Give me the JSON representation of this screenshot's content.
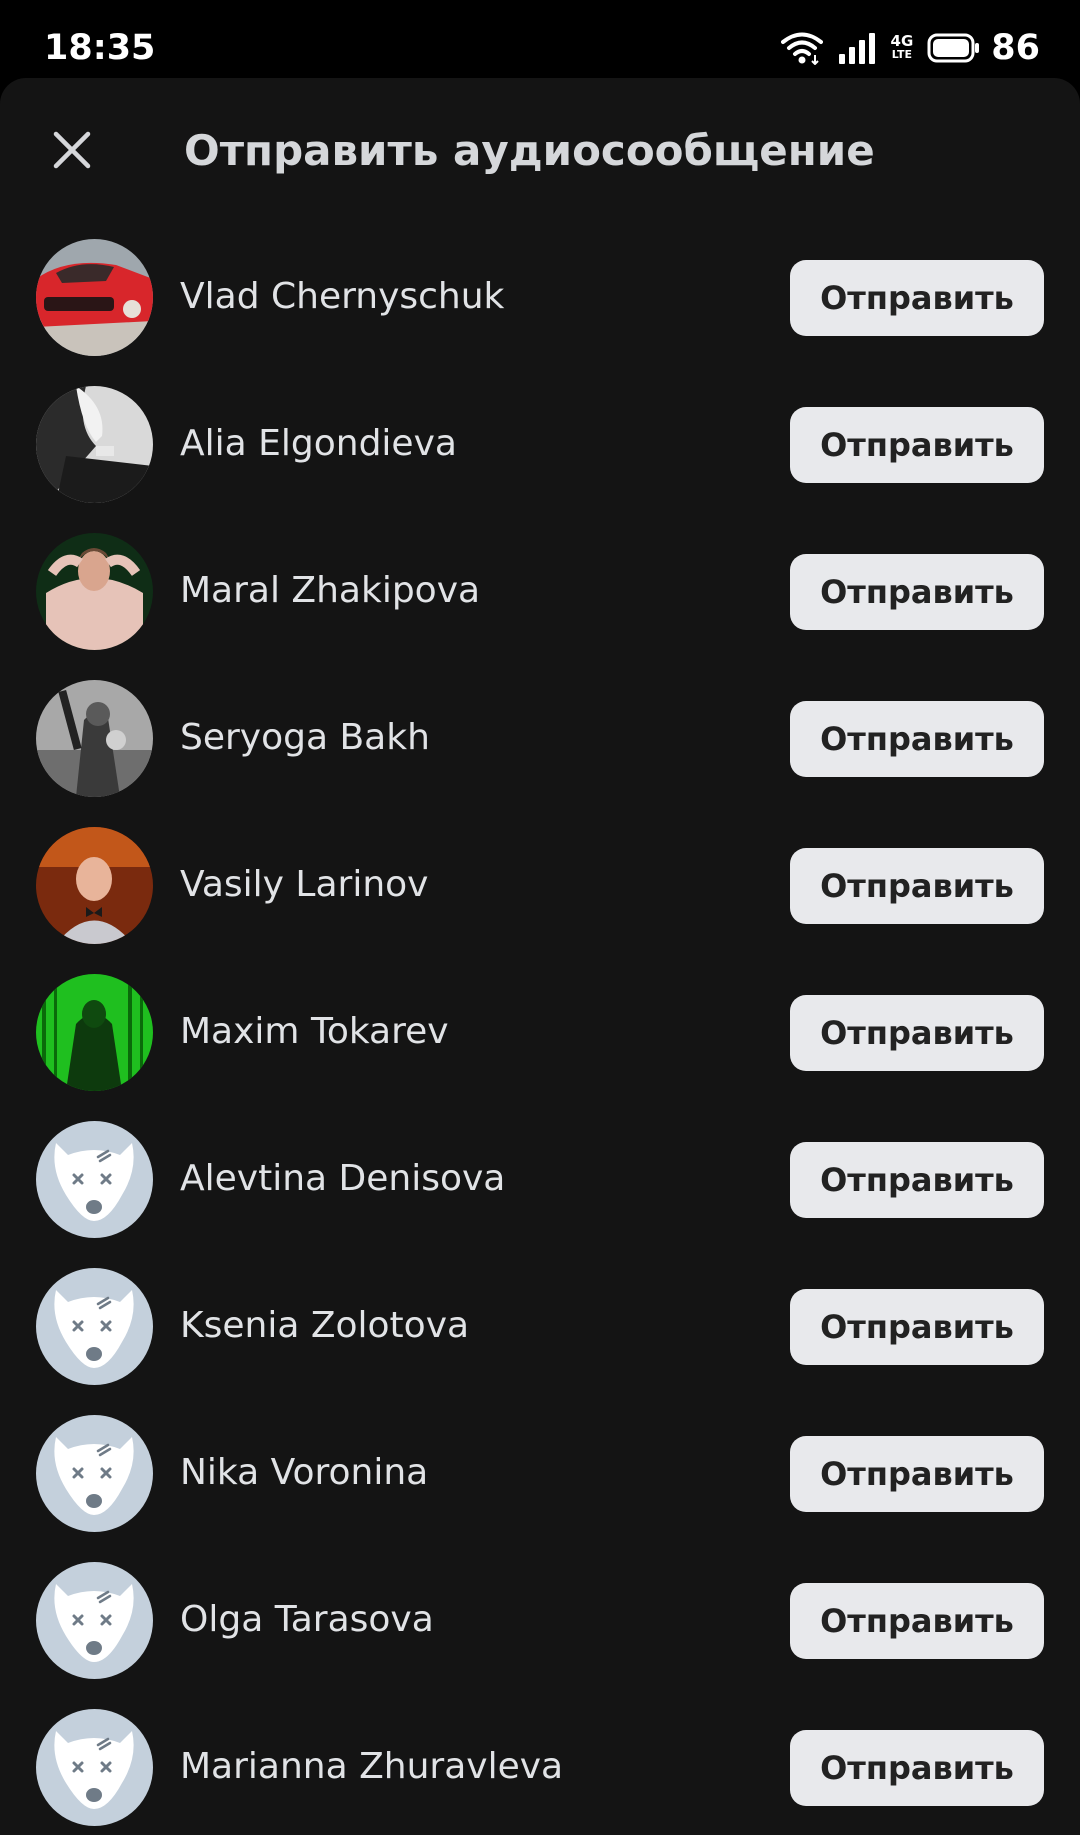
{
  "status_bar": {
    "time": "18:35",
    "network_label": "4G",
    "network_sub": "LTE",
    "battery": "86",
    "icons": [
      "wifi-icon",
      "signal-icon",
      "network-4g-icon",
      "battery-icon"
    ]
  },
  "sheet": {
    "title": "Отправить аудиосообщение",
    "close_icon": "close-icon"
  },
  "colors": {
    "background": "#141414",
    "button_bg": "#e8e9ec",
    "button_text": "#222222",
    "text": "#e1e3e6",
    "placeholder_avatar": "#c4d0dc"
  },
  "contacts": [
    {
      "name": "Vlad Chernyschuk",
      "button": "Отправить",
      "avatar": "photo"
    },
    {
      "name": "Alia Elgondieva",
      "button": "Отправить",
      "avatar": "photo"
    },
    {
      "name": "Maral Zhakipova",
      "button": "Отправить",
      "avatar": "photo"
    },
    {
      "name": "Seryoga Bakh",
      "button": "Отправить",
      "avatar": "photo"
    },
    {
      "name": "Vasily Larinov",
      "button": "Отправить",
      "avatar": "photo"
    },
    {
      "name": "Maxim Tokarev",
      "button": "Отправить",
      "avatar": "photo"
    },
    {
      "name": "Alevtina Denisova",
      "button": "Отправить",
      "avatar": "placeholder-dog-icon"
    },
    {
      "name": "Ksenia Zolotova",
      "button": "Отправить",
      "avatar": "placeholder-dog-icon"
    },
    {
      "name": "Nika Voronina",
      "button": "Отправить",
      "avatar": "placeholder-dog-icon"
    },
    {
      "name": "Olga Tarasova",
      "button": "Отправить",
      "avatar": "placeholder-dog-icon"
    },
    {
      "name": "Marianna Zhuravleva",
      "button": "Отправить",
      "avatar": "placeholder-dog-icon"
    }
  ]
}
